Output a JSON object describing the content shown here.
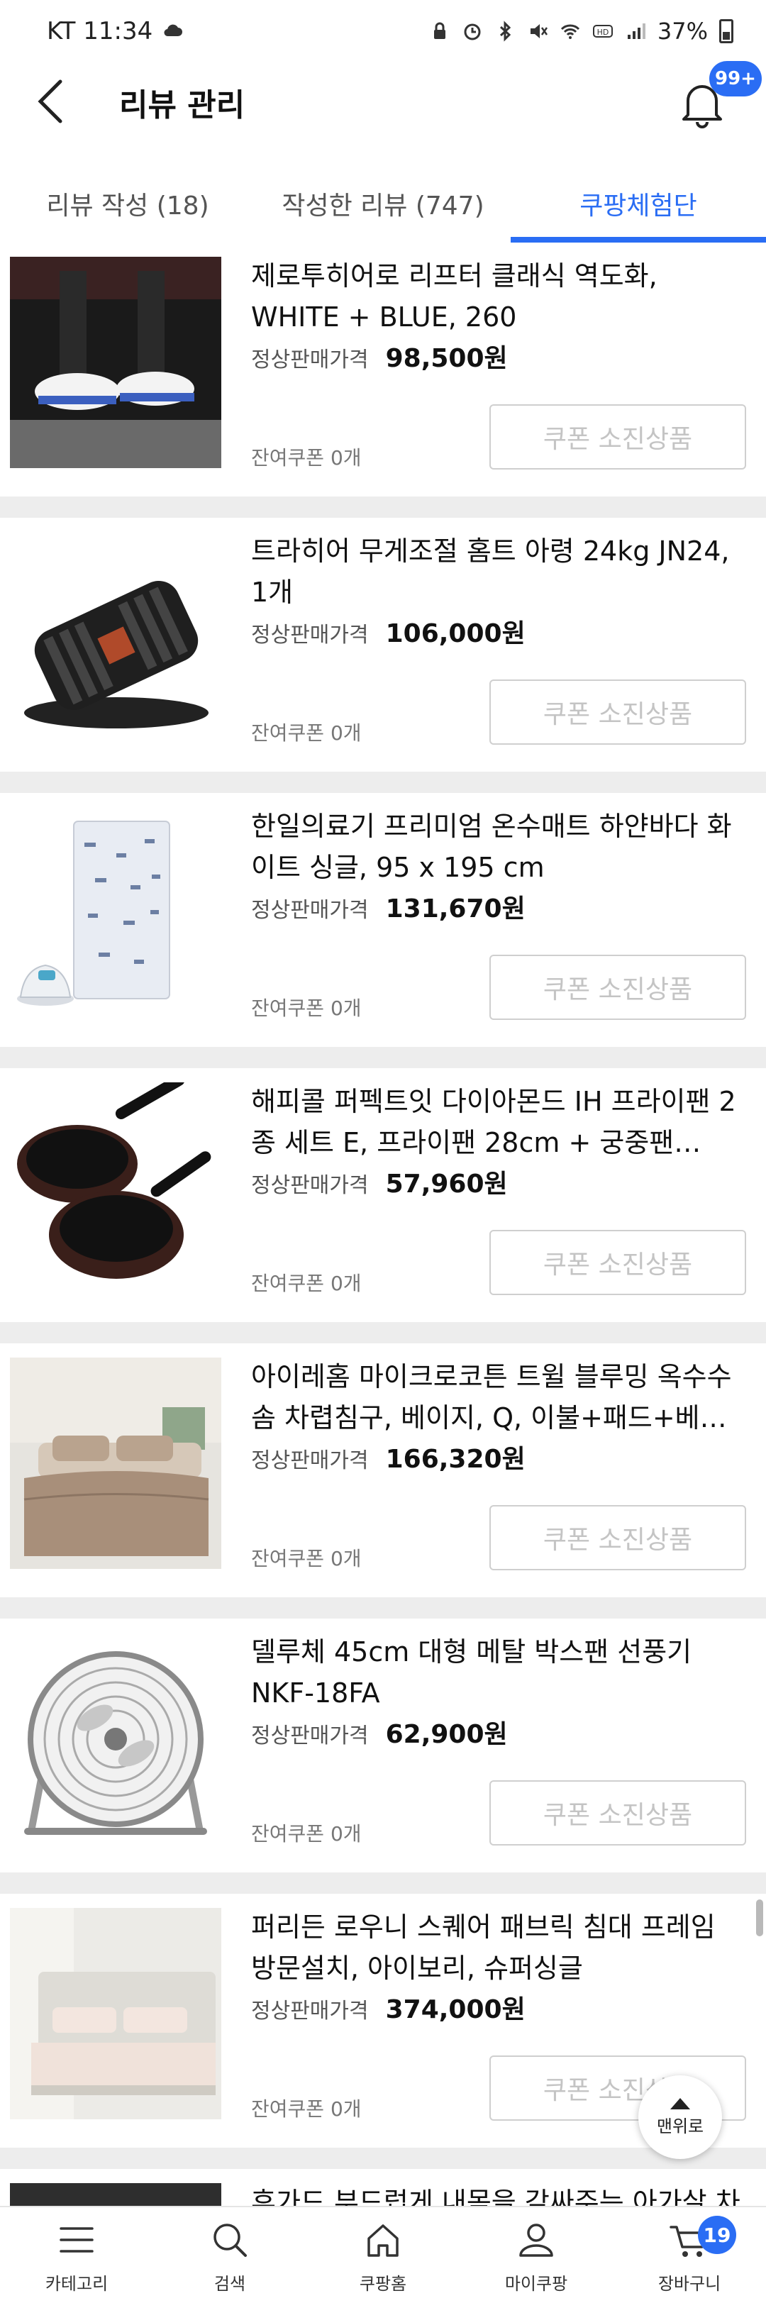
{
  "status_bar": {
    "carrier_time": "KT 11:34",
    "battery": "37%"
  },
  "header": {
    "title": "리뷰 관리",
    "notification_badge": "99+"
  },
  "tabs": [
    {
      "label": "리뷰 작성 (18)",
      "active": false
    },
    {
      "label": "작성한 리뷰 (747)",
      "active": false
    },
    {
      "label": "쿠팡체험단",
      "active": true
    }
  ],
  "common": {
    "price_label": "정상판매가격",
    "coupon_left": "잔여쿠폰 0개",
    "coupon_button": "쿠폰 소진상품"
  },
  "items": [
    {
      "name": "제로투히어로 리프터 클래식 역도화, WHITE + BLUE, 260",
      "price": "98,500원"
    },
    {
      "name": "트라히어 무게조절 홈트 아령 24kg JN24, 1개",
      "price": "106,000원"
    },
    {
      "name": "한일의료기 프리미엄 온수매트 하얀바다 화이트 싱글, 95 x 195 cm",
      "price": "131,670원"
    },
    {
      "name": "해피콜 퍼펙트잇 다이아몬드 IH 프라이팬 2종 세트 E, 프라이팬 28cm + 궁중팬 28c...",
      "price": "57,960원"
    },
    {
      "name": "아이레홈 마이크로코튼 트윌 블루밍 옥수수솜 차렵침구, 베이지, Q, 이불+패드+베개...",
      "price": "166,320원"
    },
    {
      "name": "델루체 45cm 대형 메탈 박스팬 선풍기 NKF-18FA",
      "price": "62,900원"
    },
    {
      "name": "퍼리든 로우니 스퀘어 패브릭 침대 프레임 방문설치, 아이보리, 슈퍼싱글",
      "price": "374,000원"
    }
  ],
  "partial_item": {
    "name": "휴가드 부드럽게 내몸을 감싸주는 아가살 차"
  },
  "top_button": "맨위로",
  "bottom_nav": [
    {
      "label": "카테고리",
      "icon": "menu-icon"
    },
    {
      "label": "검색",
      "icon": "search-icon"
    },
    {
      "label": "쿠팡홈",
      "icon": "home-icon"
    },
    {
      "label": "마이쿠팡",
      "icon": "user-icon"
    },
    {
      "label": "장바구니",
      "icon": "cart-icon"
    }
  ],
  "cart_badge": "19",
  "colors": {
    "accent": "#2a6df4",
    "divider": "#ededed"
  }
}
